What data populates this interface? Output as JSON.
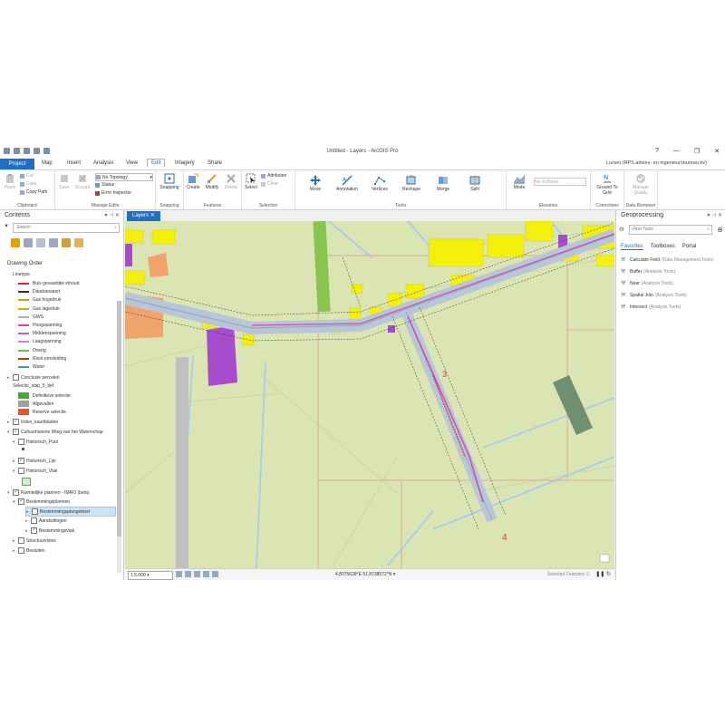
{
  "window": {
    "title": "Untitled - Layers - ArcGIS Pro",
    "help": "?",
    "min": "—",
    "max": "❐",
    "close": "✕"
  },
  "tabs": {
    "project": "Project",
    "items": [
      "Map",
      "Insert",
      "Analysis",
      "View",
      "Edit",
      "Imagery",
      "Share"
    ],
    "active": "Edit",
    "user": "Lucien (RPS advies- en ingenieursbureau bv)"
  },
  "ribbon": {
    "clipboard": {
      "label": "Clipboard",
      "paste": "Paste",
      "cut": "Cut",
      "copy": "Copy",
      "copy_path": "Copy Path"
    },
    "manage_edits": {
      "label": "Manage Edits",
      "save": "Save",
      "discard": "Discard",
      "no_topology": "No Topology",
      "status": "Status",
      "error_inspector": "Error Inspector"
    },
    "snapping": {
      "label": "Snapping",
      "snapping": "Snapping"
    },
    "features": {
      "label": "Features",
      "create": "Create",
      "modify": "Modify",
      "delete": "Delete"
    },
    "selection": {
      "label": "Selection",
      "select": "Select",
      "attributes": "Attributes",
      "clear": "Clear"
    },
    "tools": {
      "label": "Tools",
      "move": "Move",
      "annotation": "Annotation",
      "vertices": "Vertices",
      "reshape": "Reshape",
      "merge": "Merge",
      "split": "Split"
    },
    "elevation": {
      "label": "Elevation",
      "mode": "Mode",
      "no_surfaces": "No surfaces"
    },
    "corrections": {
      "label": "Corrections",
      "ground_to_grid": "Ground To Grid"
    },
    "data_reviewer": {
      "label": "Data Reviewer",
      "manage_quality": "Manage Quality"
    }
  },
  "contents": {
    "title": "Contents",
    "search_placeholder": "Search",
    "drawing_order": "Drawing Order",
    "linetype_header": "Linetype",
    "linetype_items": [
      {
        "label": "Buis gevaarlijke inhoud",
        "color": "#e8202a"
      },
      {
        "label": "Datatransport",
        "color": "#333333"
      },
      {
        "label": "Gas hogedruk",
        "color": "#c8a800"
      },
      {
        "label": "Gas lagedruk",
        "color": "#d4b000"
      },
      {
        "label": "GWS",
        "color": "#b0b0b0"
      },
      {
        "label": "Hoogspanning",
        "color": "#e040a0"
      },
      {
        "label": "Middenspanning",
        "color": "#c060c0"
      },
      {
        "label": "Laagspanning",
        "color": "#e080c0"
      },
      {
        "label": "Overig",
        "color": "#60c060"
      },
      {
        "label": "Riool-persleiding",
        "color": "#b04000"
      },
      {
        "label": "Water",
        "color": "#4a90e2"
      }
    ],
    "conclusie": "Conclusie percelen",
    "selectie_header": "Selectie_stap_5_def",
    "selectie_items": [
      {
        "label": "Definitieve selectie",
        "color": "#3fae2a"
      },
      {
        "label": "Afgevallen",
        "color": "#a0a0a0"
      },
      {
        "label": "Reserve selectie",
        "color": "#e8542a"
      }
    ],
    "index": "Index_kaartbladen",
    "cultuur": "Cultuurhistorie Wleg van het Waterschap",
    "hist_punt": "Historisch_Punt",
    "hist_lijn": "Historisch_Lijn",
    "hist_vlak": "Historisch_Vlak",
    "ruimtelijke": "Ruimtelijke plannen - IMRO (beta)",
    "bestemmingsplannen": "Bestemmingsplannen",
    "bestemmingsplangebied": "Bestemmingsplangebied",
    "aanduidingen": "Aanduidingen",
    "bestemmingsvlak": "Bestemmingsvlak",
    "structuurvisies": "Structuurvisies",
    "besluiten": "Besluiten"
  },
  "map": {
    "tab": "Layers",
    "label_4": "4",
    "label_3": "3",
    "scale": "1:5.000",
    "coordinates": "4,8075628°E 51,8738572°N",
    "selected_features": "Selected Features: 0"
  },
  "geoprocessing": {
    "title": "Geoprocessing",
    "search_placeholder": "Find Tools",
    "tabs": [
      "Favorites",
      "Toolboxes",
      "Portal"
    ],
    "tools": [
      {
        "name": "Calculate Field",
        "source": "(Data Management Tools)"
      },
      {
        "name": "Buffer",
        "source": "(Analysis Tools)"
      },
      {
        "name": "Near",
        "source": "(Analysis Tools)"
      },
      {
        "name": "Spatial Join",
        "source": "(Analysis Tools)"
      },
      {
        "name": "Intersect",
        "source": "(Analysis Tools)"
      }
    ]
  }
}
